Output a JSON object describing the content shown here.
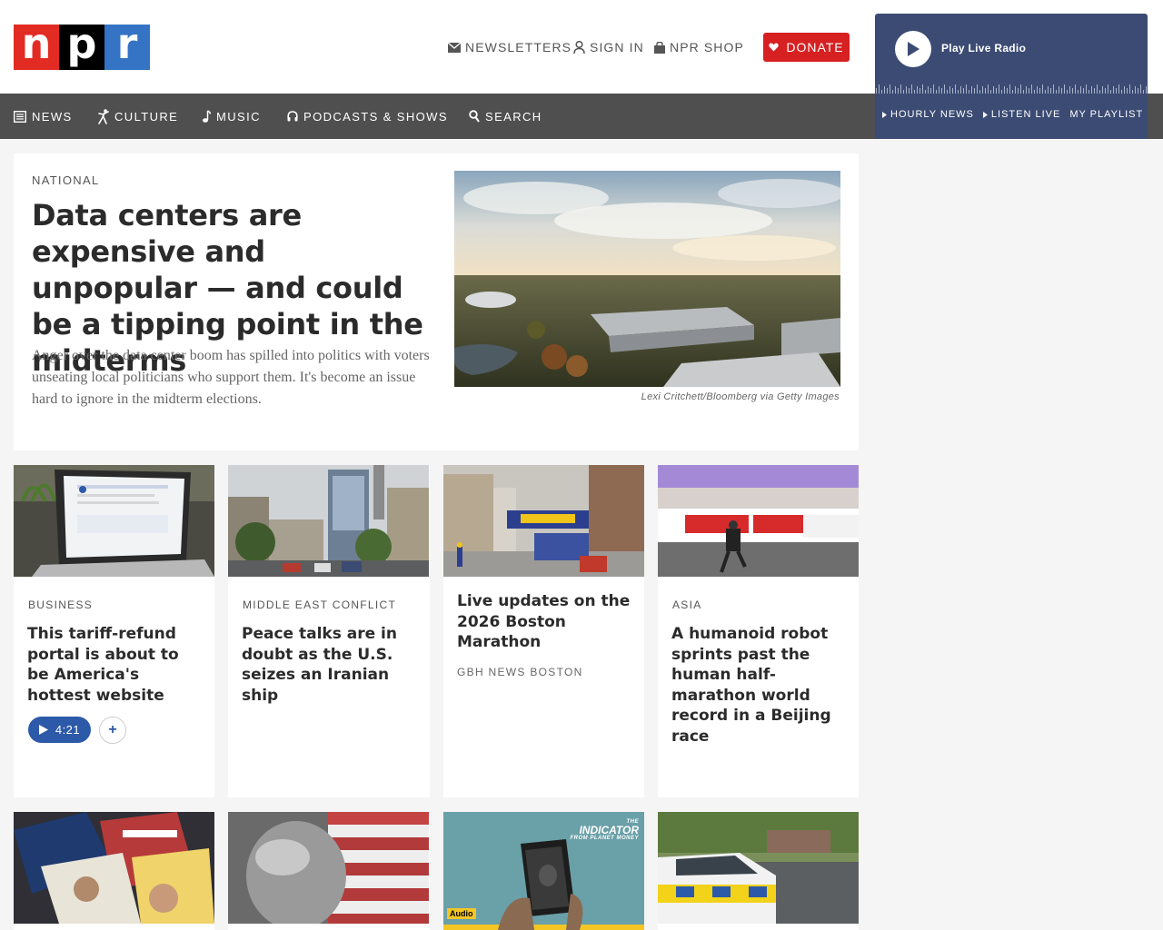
{
  "logo": {
    "letters": [
      "n",
      "p",
      "r"
    ]
  },
  "utility": {
    "newsletters": "NEWSLETTERS",
    "sign_in": "SIGN IN",
    "shop": "NPR SHOP",
    "donate": "DONATE"
  },
  "player": {
    "label": "Play Live Radio",
    "links": [
      "HOURLY NEWS",
      "LISTEN LIVE",
      "MY PLAYLIST"
    ]
  },
  "nav": {
    "news": "NEWS",
    "culture": "CULTURE",
    "music": "MUSIC",
    "podcasts": "PODCASTS & SHOWS",
    "search": "SEARCH"
  },
  "hero": {
    "kicker": "NATIONAL",
    "headline": "Data centers are expensive and unpopular — and could be a tipping point in the midterms",
    "teaser": "Anger over the data center boom has spilled into politics with voters unseating local politicians who support them. It's become an issue hard to ignore in the midterm elections.",
    "credit": "Lexi Critchett/Bloomberg via Getty Images"
  },
  "cards": [
    {
      "kicker": "BUSINESS",
      "headline": "This tariff-refund portal is about to be America's hottest website",
      "duration": "4:21"
    },
    {
      "kicker": "MIDDLE EAST CONFLICT",
      "headline": "Peace talks are in doubt as the U.S. seizes an Iranian ship"
    },
    {
      "headline": "Live updates on the 2026 Boston Marathon",
      "source": "GBH NEWS BOSTON"
    },
    {
      "kicker": "ASIA",
      "headline": "A humanoid robot sprints past the human half-marathon world record in a Beijing race"
    }
  ],
  "bottom_cards": {
    "indicator_logo_top": "THE",
    "indicator_logo": "INDICATOR",
    "indicator_logo_sub": "FROM PLANET MONEY",
    "audio_badge": "Audio"
  },
  "colors": {
    "npr_red": "#e22b23",
    "npr_blue": "#3573c5",
    "donate": "#d62021",
    "player_bg": "#3b4b73",
    "nav_bg": "#4f4f4f",
    "audio_pill": "#2d5aa8"
  }
}
